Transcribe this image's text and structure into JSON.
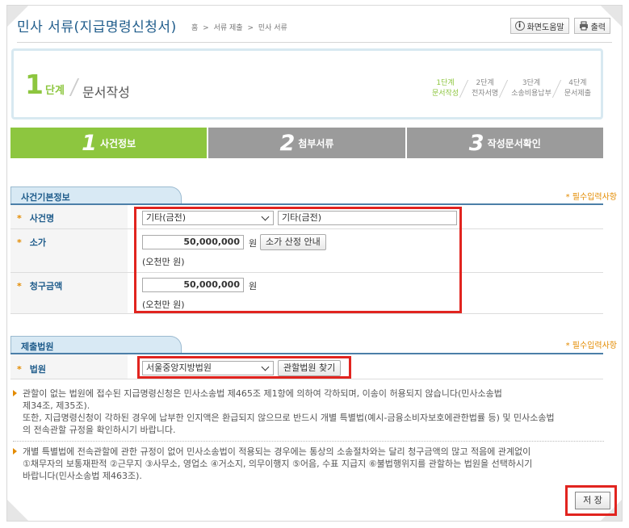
{
  "header": {
    "title": "민사 서류(지급명령신청서)",
    "breadcrumb": [
      "홈",
      ">",
      "서류 제출",
      ">",
      "민사 서류"
    ],
    "help_label": "화면도움말",
    "print_label": "출력"
  },
  "step_panel": {
    "number": "1",
    "word": "단계",
    "name": "문서작성",
    "steps": [
      {
        "top": "1단계",
        "bottom": "문서작성"
      },
      {
        "top": "2단계",
        "bottom": "전자서명"
      },
      {
        "top": "3단계",
        "bottom": "소송비용납부"
      },
      {
        "top": "4단계",
        "bottom": "문서제출"
      }
    ]
  },
  "tabs": [
    {
      "num": "1",
      "label": "사건정보"
    },
    {
      "num": "2",
      "label": "첨부서류"
    },
    {
      "num": "3",
      "label": "작성문서확인"
    }
  ],
  "case_info": {
    "title": "사건기본정보",
    "required_note": "* 필수입력사항",
    "case_name_label": "사건명",
    "case_type_value": "기타(금전)",
    "case_name_value": "기타(금전)",
    "claim_value_label": "소가",
    "claim_value_amount": "50,000,000",
    "won": "원",
    "claim_value_help": "소가 산정 안내",
    "claim_value_words": "(오천만 원)",
    "claim_amount_label": "청구금액",
    "claim_amount_value": "50,000,000",
    "claim_amount_words": "(오천만 원)"
  },
  "court": {
    "title": "제출법원",
    "required_note": "* 필수입력사항",
    "court_label": "법원",
    "court_value": "서울중앙지방법원",
    "find_button": "관할법원 찾기"
  },
  "notes": [
    {
      "lines": [
        "관할이 없는 법원에 접수된 지급명령신청은 민사소송법 제465조 제1항에 의하여 각하되며, 이송이 허용되지 않습니다(민사소송법",
        "제34조, 제35조).",
        "또한, 지급명령신청이 각하된 경우에 납부한 인지액은 환급되지 않으므로 반드시 개별 특별법(예시-금융소비자보호에관한법률 등) 및 민사소송법",
        "의 전속관할 규정을 확인하시기 바랍니다."
      ]
    },
    {
      "lines": [
        "개별 특별법에 전속관할에 관한 규정이 없어 민사소송법이 적용되는 경우에는 통상의 소송절차와는 달리 청구금액의 많고 적음에 관계없이",
        "①채무자의 보통재판적 ②근무지 ③사무소, 영업소 ④거소지, 의무이행지 ⑤어음, 수표 지급지 ⑥불법행위지를 관할하는 법원을 선택하시기",
        "바랍니다(민사소송법 제463조)."
      ]
    }
  ],
  "save_label": "저 장",
  "colors": {
    "accent_green": "#8dc63f",
    "title_blue": "#1f5c8b",
    "highlight_red": "#e1241f",
    "required_orange": "#e38b00"
  }
}
